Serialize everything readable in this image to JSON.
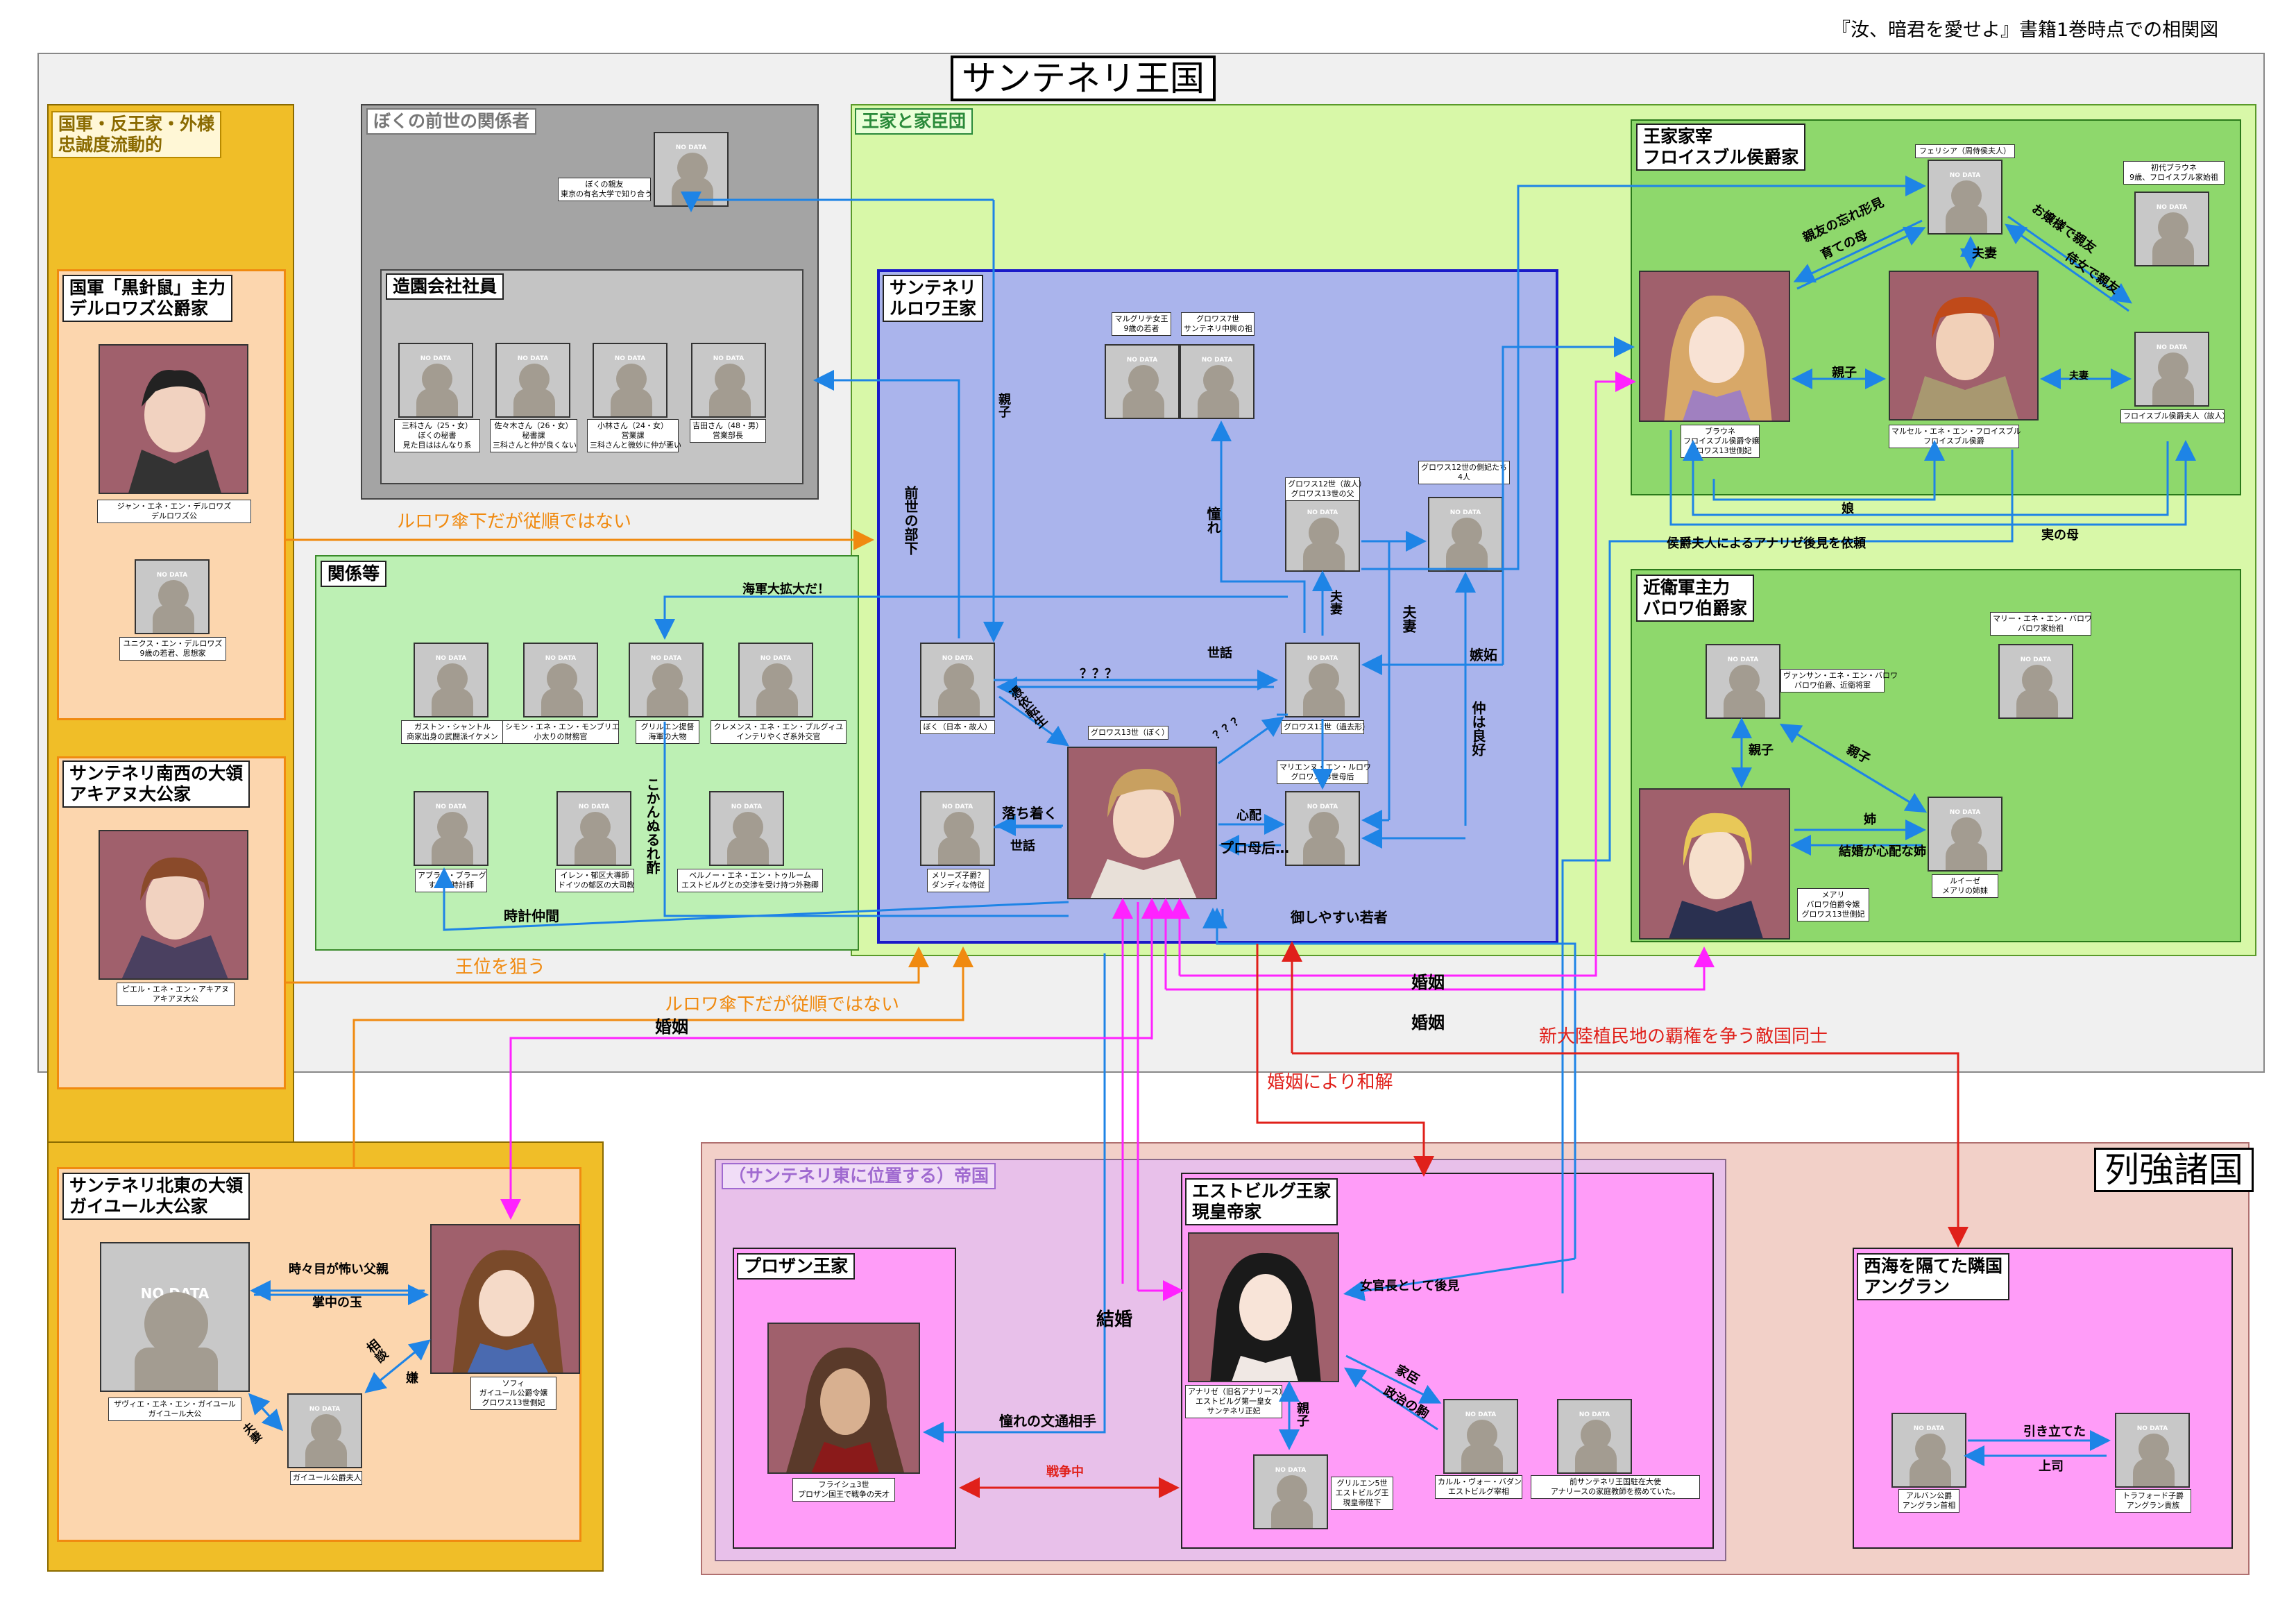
{
  "header_caption": "『汝、暗君を愛せよ』書籍1巻時点での相関図",
  "regions": {
    "santeneri_kingdom": "サンテネリ王国",
    "anti_royal": "国軍・反王家・外様\n忠誠度流動的",
    "past_life": "ぼくの前世の関係者",
    "landscape_company": "造園会社社員",
    "royal_and_vassals": "王家と家臣団",
    "related": "関係等",
    "rurowa_royal": "サンテネリ\nルロワ王家",
    "froisble": "王家家宰\nフロイスブル侯爵家",
    "barowa": "近衛軍主力\nバロワ伯爵家",
    "derurowaz": "国軍「黒針鼠」主力\nデルロワズ公爵家",
    "akiane": "サンテネリ南西の大領\nアキアヌ大公家",
    "gaiyule": "サンテネリ北東の大領\nガイユール大公家",
    "powers": "列強諸国",
    "empire": "（サンテネリ東に位置する）帝国",
    "prozan": "プロザン王家",
    "estbirg": "エストビルグ王家\n現皇帝家",
    "angran": "西海を隔てた隣国\nアングラン"
  },
  "no_data_text": "NO DATA",
  "people": {
    "past_friend": "ぼくの親友\n東京の有名大学で知り合う",
    "mishina": "三科さん（25・女）\nぼくの秘書\n見た目ははんなり系",
    "sasaki": "佐々木さん（26・女）\n秘書課\n三科さんと仲が良くない",
    "kobayashi": "小林さん（24・女）\n営業課\n三科さんと微妙に仲が悪い",
    "yoshida": "吉田さん（48・男）\n営業部長",
    "marguerite": "マルグリテ女王\n9歳の若者",
    "gros7": "グロワス7世\nサンテネリ中興の祖",
    "gros12": "グロワス12世（故人）\nグロワス13世の父",
    "gros12_wives": "グロワス12世の側妃たち\n4人",
    "boku": "ぼく（日本・故人）",
    "gros13_king": "グロワス13世（ぼく）",
    "gros13_old": "グロワス13世（過去形）",
    "marie_ruvwa": "マリエンヌ・エン・ルロワ\nグロワス13世母后",
    "meriz": "メリーズ子爵？\nダンディな侍従",
    "gaston": "ガストン・シャントル\n商家出身の武闘派イケメン",
    "simon": "シモン・エネ・エン・モンブリエ\n小太りの財務官",
    "grillen": "グリルエン提督\n海軍の大物",
    "clemens": "クレメンス・エネ・エン・ブルグィユ\nインテリやくざ系外交官",
    "abram": "アブラム・ブラーグ\nすごい時計師",
    "irene": "イレン・郁区大導師\nドイツの郁区の大司教",
    "bernot": "ベルノー・エネ・エン・トゥルーム\nエストビルグとの交渉を受け持つ外務卿",
    "felicia": "フェリシア（周侍侯夫人）",
    "first_braune": "初代ブラウネ\n9歳、フロイスブル家始祖",
    "braune": "ブラウネ\nフロイスブル侯爵令嬢\nグロワス13世側妃",
    "marcel": "マルセル・エネ・エン・フロイスブル\nフロイスブル侯爵",
    "froisble_wife": "フロイスブル侯爵夫人（故人）",
    "vancen": "ヴァンサン・エネ・エン・バロワ\nバロワ伯爵、近衛将軍",
    "marie_barowa": "マリー・エネ・エン・バロワ\nバロワ家始祖",
    "meri": "メアリ\nバロワ伯爵令嬢\nグロワス13世側妃",
    "luise": "ルイーゼ\nメアリの姉妹",
    "jean": "ジャン・エネ・エン・デルロワズ\nデルロワズ公",
    "yunix": "ユニクス・エン・デルロワズ\n9歳の若君、思想家",
    "pierre": "ピエル・エネ・エン・アキアヌ\nアキアヌ大公",
    "xavier": "ザヴィエ・エネ・エン・ガイユール\nガイユール大公",
    "sophie": "ソフィ\nガイユール公爵令嬢\nグロワス13世側妃",
    "gaiyule_wife": "ガイユール公爵夫人",
    "frederic": "フライシュ3世\nプロザン国王で戦争の天才",
    "anarise": "アナリゼ（旧名アナリース）\nエストビルグ第一皇女\nサンテネリ正妃",
    "karl": "カルル・ヴォー・バダン\nエストビルグ宰相",
    "former_pm": "前サンテネリ王国駐在大使\nアナリースの家庭教師を務めていた。",
    "grilbegu": "グリルエン5世\nエストビルグ王\n現皇帝陛下",
    "alvin": "アルバン公爵\nアングラン首相",
    "trafford": "トラフォード子爵\nアングラン貴族"
  },
  "relations": {
    "rurowa_not_obedient_1": "ルロワ傘下だが従順ではない",
    "rurowa_not_obedient_2": "ルロワ傘下だが従順ではない",
    "aim_throne": "王位を狙う",
    "marriage_1": "婚姻",
    "marriage_2": "婚姻",
    "marriage_3": "婚姻",
    "reconcile": "婚姻により和解",
    "rival": "新大陸植民地の覇権を争う敵国同士",
    "at_war": "戦争中",
    "past_subordinate": "前世の部下",
    "parent_child": "親子",
    "admire": "憧れ",
    "navy": "海軍大拡大だ！",
    "reincarnate": "憑依転生",
    "care": "世話",
    "care_2": "世話",
    "care_3": "世話",
    "qqq_1": "？？？",
    "qqq_2": "？？？",
    "calm": "落ち着く",
    "worry": "心配",
    "mother_pro": "プロ母后…",
    "easy_youth": "御しやすい若者",
    "clock_friend": "時計仲間",
    "kanvuare": "こかんぬるれ酢",
    "husband_wife": "夫妻",
    "husband_wife_2": "夫妻",
    "get_along": "仲は良好",
    "jealous": "嫉妬",
    "spouse": "夫妻",
    "friend_lost": "親友の忘れ形見",
    "foster": "育ての母",
    "parent_child_fr": "親子",
    "mutual_friend": "お嬢様で親友",
    "attendant": "侍女で親友",
    "daughter": "娘",
    "true_mother": "実の母",
    "requests": "侯爵夫人によるアナリゼ後見を依頼",
    "parent_b1": "親子",
    "parent_b2": "親子",
    "sister": "姉",
    "worried_sister": "結婚が心配な姉",
    "scary_father": "時々目が怖い父親",
    "treasure": "掌中の玉",
    "consult": "相談",
    "vassal_b": "嫌",
    "couple": "夫妻",
    "lady_guard": "女官長として後見",
    "retainer": "家臣",
    "political_foe": "政治の駒",
    "parent_e": "親子",
    "admired_partner": "憧れの文通相手",
    "marriage_kanji": "結婚",
    "promote": "引き立てた",
    "boss": "上司"
  },
  "colors": {
    "orange_arrow": "#f08a10",
    "blue_arrow": "#1e84e6",
    "magenta_arrow": "#ff22ff",
    "red_arrow": "#e0201a",
    "kingdom_bg": "#f0f0f0",
    "anti_royal_bg": "#f0be28",
    "vassal_bg": "#d8f8a8",
    "rurowa_bg": "#aab4ec",
    "froisble_bg": "#8ed86c",
    "powers_bg": "#f2d0c8",
    "empire_bg": "#e8c0ea",
    "house_bg": "#ff9cf8",
    "peach_bg": "#fcd6ae",
    "gray_bg": "#a4a4a4"
  }
}
